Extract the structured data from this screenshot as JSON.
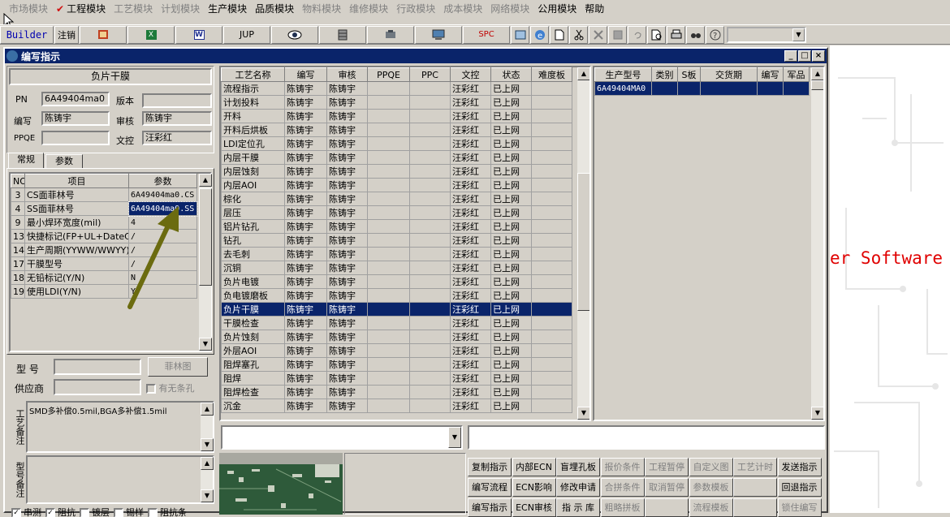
{
  "menu": [
    {
      "label": "市场模块",
      "enabled": false,
      "checked": false
    },
    {
      "label": "工程模块",
      "enabled": true,
      "checked": true
    },
    {
      "label": "工艺模块",
      "enabled": false,
      "checked": false
    },
    {
      "label": "计划模块",
      "enabled": false,
      "checked": false
    },
    {
      "label": "生产模块",
      "enabled": true,
      "checked": false
    },
    {
      "label": "品质模块",
      "enabled": true,
      "checked": false
    },
    {
      "label": "物料模块",
      "enabled": false,
      "checked": false
    },
    {
      "label": "维修模块",
      "enabled": false,
      "checked": false
    },
    {
      "label": "行政模块",
      "enabled": false,
      "checked": false
    },
    {
      "label": "成本模块",
      "enabled": false,
      "checked": false
    },
    {
      "label": "网络模块",
      "enabled": false,
      "checked": false
    },
    {
      "label": "公用模块",
      "enabled": true,
      "checked": false
    },
    {
      "label": "帮助",
      "enabled": true,
      "checked": false
    }
  ],
  "toolbar": {
    "builder": "Builder",
    "logout": "注销",
    "jup": "JUP",
    "spc": "SPC"
  },
  "bg_text": "er Software",
  "window": {
    "title": "编写指示",
    "controls": {
      "min": "_",
      "max": "□",
      "close": "×"
    }
  },
  "left": {
    "header": "负片干膜",
    "pn_label": "PN",
    "pn_value": "6A49404ma0",
    "version_label": "版本",
    "version_value": "",
    "writer_label": "编写",
    "writer_value": "陈铸宇",
    "reviewer_label": "审核",
    "reviewer_value": "陈铸宇",
    "ppqe_label": "PPQE",
    "ppqe_value": "",
    "doc_label": "文控",
    "doc_value": "汪彩红",
    "tabs": [
      "常规",
      "参数"
    ],
    "param_headers": [
      "NO",
      "项目",
      "参数"
    ],
    "params": [
      {
        "no": "3",
        "item": "CS面菲林号",
        "value": "6A49404ma0.CS",
        "sel": false
      },
      {
        "no": "4",
        "item": "SS面菲林号",
        "value": "6A49404ma0.SS",
        "sel": true
      },
      {
        "no": "9",
        "item": "最小焊环宽度(mil)",
        "value": "4",
        "sel": false
      },
      {
        "no": "13",
        "item": "快捷标记(FP+UL+DateC",
        "value": "/",
        "sel": false
      },
      {
        "no": "14",
        "item": "生产周期(YYWW/WWYY)",
        "value": "/",
        "sel": false
      },
      {
        "no": "17",
        "item": "干膜型号",
        "value": "/",
        "sel": false
      },
      {
        "no": "18",
        "item": "无铅标记(Y/N)",
        "value": "N",
        "sel": false
      },
      {
        "no": "19",
        "item": "使用LDI(Y/N)",
        "value": "Y",
        "sel": false
      }
    ],
    "model_label": "型  号",
    "model_value": "",
    "film_button": "菲林图",
    "supplier_label": "供应商",
    "supplier_value": "",
    "has_code_label": "有无条孔",
    "process_note_label": "工艺备注",
    "process_note": "SMD多补偿0.5mil,BGA多补偿1.5mil",
    "model_note_label": "型号备注",
    "model_note": "",
    "bottom_checks": [
      "串测",
      "阻抗",
      "镀层",
      "锡样",
      "阻抗条"
    ]
  },
  "process_table": {
    "headers": [
      "工艺名称",
      "编写",
      "审核",
      "PPQE",
      "PPC",
      "文控",
      "状态",
      "难度板"
    ],
    "rows": [
      [
        "流程指示",
        "陈铸宇",
        "陈铸宇",
        "",
        "",
        "汪彩红",
        "已上网",
        ""
      ],
      [
        "计划投料",
        "陈铸宇",
        "陈铸宇",
        "",
        "",
        "汪彩红",
        "已上网",
        ""
      ],
      [
        "开料",
        "陈铸宇",
        "陈铸宇",
        "",
        "",
        "汪彩红",
        "已上网",
        ""
      ],
      [
        "开料后烘板",
        "陈铸宇",
        "陈铸宇",
        "",
        "",
        "汪彩红",
        "已上网",
        ""
      ],
      [
        "LDI定位孔",
        "陈铸宇",
        "陈铸宇",
        "",
        "",
        "汪彩红",
        "已上网",
        ""
      ],
      [
        "内层干膜",
        "陈铸宇",
        "陈铸宇",
        "",
        "",
        "汪彩红",
        "已上网",
        ""
      ],
      [
        "内层蚀刻",
        "陈铸宇",
        "陈铸宇",
        "",
        "",
        "汪彩红",
        "已上网",
        ""
      ],
      [
        "内层AOI",
        "陈铸宇",
        "陈铸宇",
        "",
        "",
        "汪彩红",
        "已上网",
        ""
      ],
      [
        "棕化",
        "陈铸宇",
        "陈铸宇",
        "",
        "",
        "汪彩红",
        "已上网",
        ""
      ],
      [
        "层压",
        "陈铸宇",
        "陈铸宇",
        "",
        "",
        "汪彩红",
        "已上网",
        ""
      ],
      [
        "铝片钻孔",
        "陈铸宇",
        "陈铸宇",
        "",
        "",
        "汪彩红",
        "已上网",
        ""
      ],
      [
        "钻孔",
        "陈铸宇",
        "陈铸宇",
        "",
        "",
        "汪彩红",
        "已上网",
        ""
      ],
      [
        "去毛刺",
        "陈铸宇",
        "陈铸宇",
        "",
        "",
        "汪彩红",
        "已上网",
        ""
      ],
      [
        "沉铜",
        "陈铸宇",
        "陈铸宇",
        "",
        "",
        "汪彩红",
        "已上网",
        ""
      ],
      [
        "负片电镀",
        "陈铸宇",
        "陈铸宇",
        "",
        "",
        "汪彩红",
        "已上网",
        ""
      ],
      [
        "负电镀磨板",
        "陈铸宇",
        "陈铸宇",
        "",
        "",
        "汪彩红",
        "已上网",
        ""
      ],
      [
        "负片干膜",
        "陈铸宇",
        "陈铸宇",
        "",
        "",
        "汪彩红",
        "已上网",
        ""
      ],
      [
        "干膜检查",
        "陈铸宇",
        "陈铸宇",
        "",
        "",
        "汪彩红",
        "已上网",
        ""
      ],
      [
        "负片蚀刻",
        "陈铸宇",
        "陈铸宇",
        "",
        "",
        "汪彩红",
        "已上网",
        ""
      ],
      [
        "外层AOI",
        "陈铸宇",
        "陈铸宇",
        "",
        "",
        "汪彩红",
        "已上网",
        ""
      ],
      [
        "阻焊塞孔",
        "陈铸宇",
        "陈铸宇",
        "",
        "",
        "汪彩红",
        "已上网",
        ""
      ],
      [
        "阻焊",
        "陈铸宇",
        "陈铸宇",
        "",
        "",
        "汪彩红",
        "已上网",
        ""
      ],
      [
        "阻焊检查",
        "陈铸宇",
        "陈铸宇",
        "",
        "",
        "汪彩红",
        "已上网",
        ""
      ],
      [
        "沉金",
        "陈铸宇",
        "陈铸宇",
        "",
        "",
        "汪彩红",
        "已上网",
        ""
      ]
    ],
    "selected_row": 16
  },
  "model_table": {
    "headers": [
      "生产型号",
      "类别",
      "S板",
      "交货期",
      "编写",
      "军品"
    ],
    "rows": [
      [
        "6A49404MA0",
        "",
        "",
        "",
        "",
        ""
      ]
    ]
  },
  "buttons": [
    [
      {
        "label": "复制指示",
        "enabled": true
      },
      {
        "label": "内部ECN",
        "enabled": true
      },
      {
        "label": "盲埋孔板",
        "enabled": true
      },
      {
        "label": "报价条件",
        "enabled": false
      },
      {
        "label": "工程暂停",
        "enabled": false
      },
      {
        "label": "自定义图",
        "enabled": false
      },
      {
        "label": "工艺计时",
        "enabled": false
      },
      {
        "label": "发送指示",
        "enabled": true
      }
    ],
    [
      {
        "label": "编写流程",
        "enabled": true
      },
      {
        "label": "ECN影响",
        "enabled": true
      },
      {
        "label": "修改申请",
        "enabled": true
      },
      {
        "label": "合拼条件",
        "enabled": false
      },
      {
        "label": "取消暂停",
        "enabled": false
      },
      {
        "label": "参数模板",
        "enabled": false
      },
      {
        "label": "",
        "enabled": false
      },
      {
        "label": "回退指示",
        "enabled": true
      }
    ],
    [
      {
        "label": "编写指示",
        "enabled": true
      },
      {
        "label": "ECN审核",
        "enabled": true
      },
      {
        "label": "指 示 库",
        "enabled": true
      },
      {
        "label": "粗略拼板",
        "enabled": false
      },
      {
        "label": "",
        "enabled": false
      },
      {
        "label": "流程模板",
        "enabled": false
      },
      {
        "label": "",
        "enabled": false
      },
      {
        "label": "锁住编写",
        "enabled": false
      }
    ]
  ],
  "colors": {
    "selection": "#0a246a",
    "face": "#d4d0c8",
    "arrow": "#6b6b0f"
  }
}
